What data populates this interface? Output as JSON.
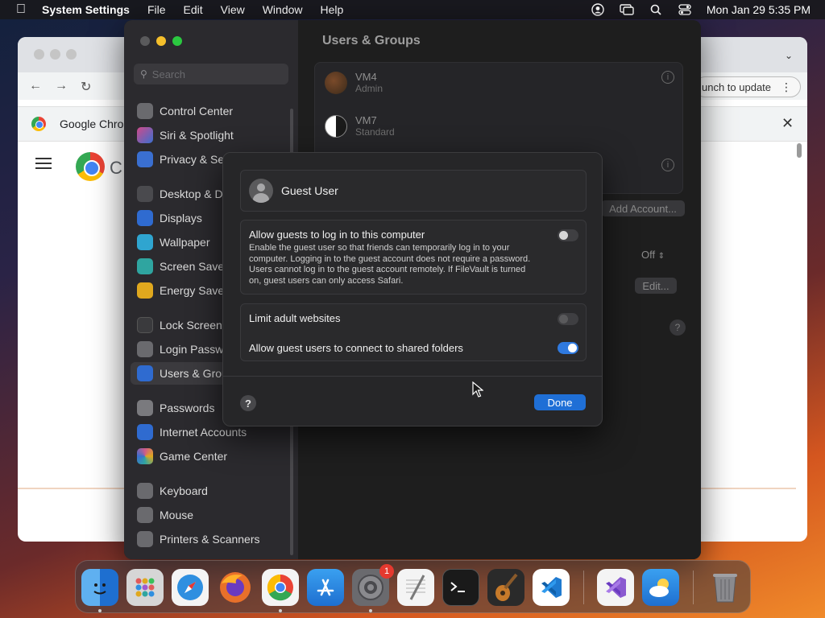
{
  "menubar": {
    "app_name": "System Settings",
    "menus": [
      "File",
      "Edit",
      "View",
      "Window",
      "Help"
    ],
    "clock": "Mon Jan 29  5:35 PM",
    "icons": [
      "user-icon",
      "screen-mirror-icon",
      "search-icon",
      "control-center-icon"
    ]
  },
  "chrome": {
    "infobar_title": "Google Chrome",
    "relaunch_label": "unch to update",
    "page_letter": "C"
  },
  "settings": {
    "search_placeholder": "Search",
    "sidebar": [
      {
        "label": "Control Center",
        "icon": "control-center-icon",
        "color": "#6a6a6e"
      },
      {
        "label": "Siri & Spotlight",
        "icon": "siri-icon",
        "color": "#b03a6e"
      },
      {
        "label": "Privacy & Sec",
        "icon": "hand-icon",
        "color": "#3a6fd0"
      },
      {
        "label": "Desktop & Do",
        "icon": "desktop-icon",
        "color": "#4a4a4e"
      },
      {
        "label": "Displays",
        "icon": "sun-icon",
        "color": "#2f6bd0"
      },
      {
        "label": "Wallpaper",
        "icon": "wallpaper-icon",
        "color": "#2fa5d0"
      },
      {
        "label": "Screen Saver",
        "icon": "screensaver-icon",
        "color": "#2fa5a0"
      },
      {
        "label": "Energy Saver",
        "icon": "bulb-icon",
        "color": "#e0a81e"
      },
      {
        "label": "Lock Screen",
        "icon": "lock-icon",
        "color": "#3a3a3d"
      },
      {
        "label": "Login Passwo",
        "icon": "key-icon",
        "color": "#6a6a6e"
      },
      {
        "label": "Users & Grou",
        "icon": "users-icon",
        "color": "#2f6bd0"
      },
      {
        "label": "Passwords",
        "icon": "key-icon",
        "color": "#7a7a7e"
      },
      {
        "label": "Internet Accounts",
        "icon": "at-icon",
        "color": "#2f6bd0"
      },
      {
        "label": "Game Center",
        "icon": "game-center-icon",
        "color": "#d05a8a"
      },
      {
        "label": "Keyboard",
        "icon": "keyboard-icon",
        "color": "#6a6a6e"
      },
      {
        "label": "Mouse",
        "icon": "mouse-icon",
        "color": "#6a6a6e"
      },
      {
        "label": "Printers & Scanners",
        "icon": "printer-icon",
        "color": "#6a6a6e"
      }
    ],
    "title": "Users & Groups",
    "users": [
      {
        "name": "VM4",
        "role": "Admin"
      },
      {
        "name": "VM7",
        "role": "Standard"
      }
    ],
    "add_account_label": "Add Account...",
    "off_label": "Off",
    "edit_label": "Edit...",
    "help_label": "?"
  },
  "sheet": {
    "guest_title": "Guest User",
    "allow_login": {
      "title": "Allow guests to log in to this computer",
      "desc": "Enable the guest user so that friends can temporarily log in to your computer. Logging in to the guest account does not require a password. Users cannot log in to the guest account remotely. If FileVault is turned on, guest users can only access Safari.",
      "on": false
    },
    "limit_adult": {
      "title": "Limit adult websites",
      "on": false
    },
    "shared_folders": {
      "title": "Allow guest users to connect to shared folders",
      "on": true
    },
    "help_label": "?",
    "done_label": "Done"
  },
  "dock": {
    "badge": "1",
    "apps": [
      {
        "name": "Finder",
        "icon": "finder-icon",
        "color": "#1e88e5"
      },
      {
        "name": "Launchpad",
        "icon": "launchpad-icon",
        "color": "#d6d6d6"
      },
      {
        "name": "Safari",
        "icon": "safari-icon",
        "color": "#1e88e5"
      },
      {
        "name": "Firefox",
        "icon": "firefox-icon",
        "color": "#e8702a"
      },
      {
        "name": "Chrome",
        "icon": "chrome-icon",
        "color": "#ffffff"
      },
      {
        "name": "App Store",
        "icon": "app-store-icon",
        "color": "#1e88e5"
      },
      {
        "name": "System Settings",
        "icon": "gear-icon",
        "color": "#6a6a6e"
      },
      {
        "name": "TextEdit",
        "icon": "textedit-icon",
        "color": "#f4f4f4"
      },
      {
        "name": "Terminal",
        "icon": "terminal-icon",
        "color": "#1a1a1a"
      },
      {
        "name": "GarageBand",
        "icon": "guitar-icon",
        "color": "#2a2a2a"
      },
      {
        "name": "VS Code",
        "icon": "vscode-icon",
        "color": "#ffffff"
      },
      {
        "name": "Visual Studio",
        "icon": "visual-studio-icon",
        "color": "#f4f4f4"
      },
      {
        "name": "Weather",
        "icon": "weather-icon",
        "color": "#2f8fe0"
      },
      {
        "name": "Trash",
        "icon": "trash-icon",
        "color": "#6a6a6e"
      }
    ]
  }
}
